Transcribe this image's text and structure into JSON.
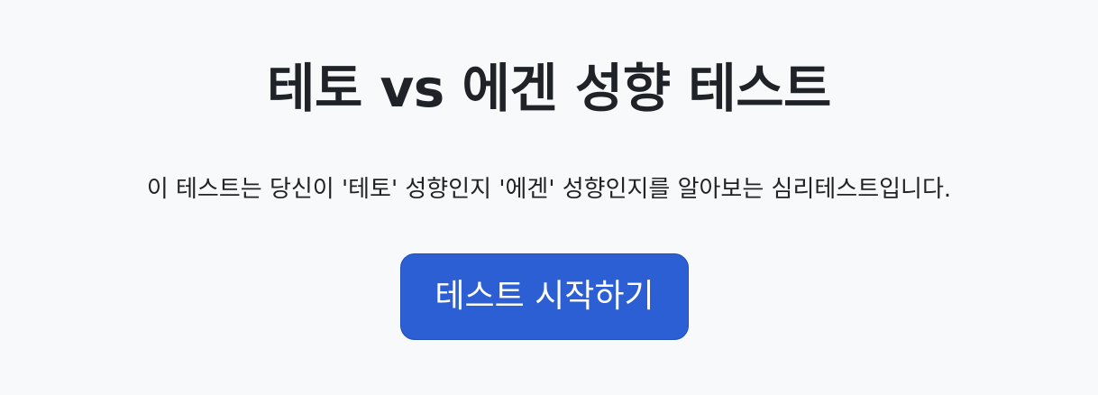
{
  "page": {
    "title": "테토 vs 에겐 성향 테스트",
    "description": "이 테스트는 당신이 '테토' 성향인지 '에겐' 성향인지를 알아보는 심리테스트입니다.",
    "start_button_label": "테스트 시작하기"
  },
  "colors": {
    "background": "#f8f9fa",
    "text": "#222222",
    "button_bg": "#2b5fd3",
    "button_text": "#ffffff"
  }
}
